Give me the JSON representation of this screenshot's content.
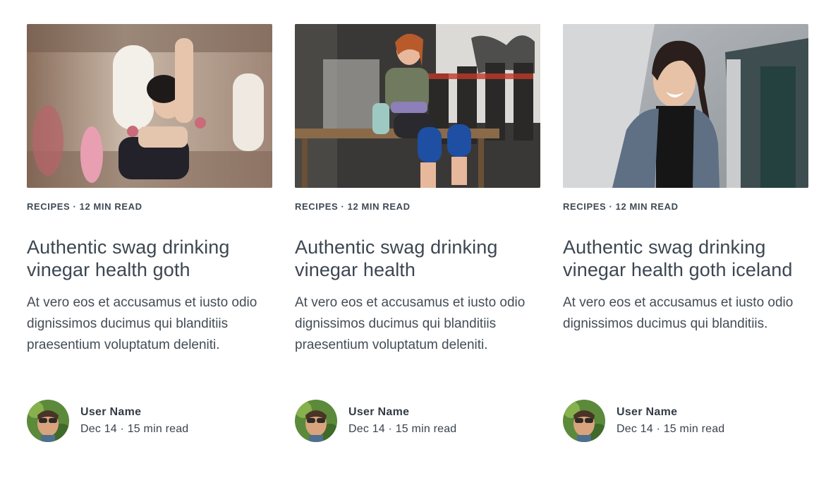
{
  "cards": [
    {
      "image_alt": "women-exercising-with-dumbbells-photo",
      "meta": "RECIPES · 12 MIN READ",
      "title": "Authentic swag drinking vinegar health goth",
      "excerpt": "At vero eos et accusamus et iusto odio dignissimos ducimus qui blanditiis praesentium voluptatum deleniti.",
      "author": {
        "name": "User Name",
        "sub": "Dec 14 · 15 min read"
      }
    },
    {
      "image_alt": "woman-sitting-in-gym-photo",
      "meta": "RECIPES · 12 MIN READ",
      "title": "Authentic swag drinking vinegar health",
      "excerpt": "At vero eos et accusamus et iusto odio dignissimos ducimus qui blanditiis praesentium voluptatum deleniti.",
      "author": {
        "name": "User Name",
        "sub": "Dec 14 · 15 min read"
      }
    },
    {
      "image_alt": "laughing-woman-denim-jacket-photo",
      "meta": "RECIPES · 12 MIN READ",
      "title": "Authentic swag drinking vinegar health goth iceland",
      "excerpt": "At vero eos et accusamus et iusto odio dignissimos ducimus qui blanditiis.",
      "author": {
        "name": "User Name",
        "sub": "Dec 14 · 15 min read"
      }
    }
  ]
}
